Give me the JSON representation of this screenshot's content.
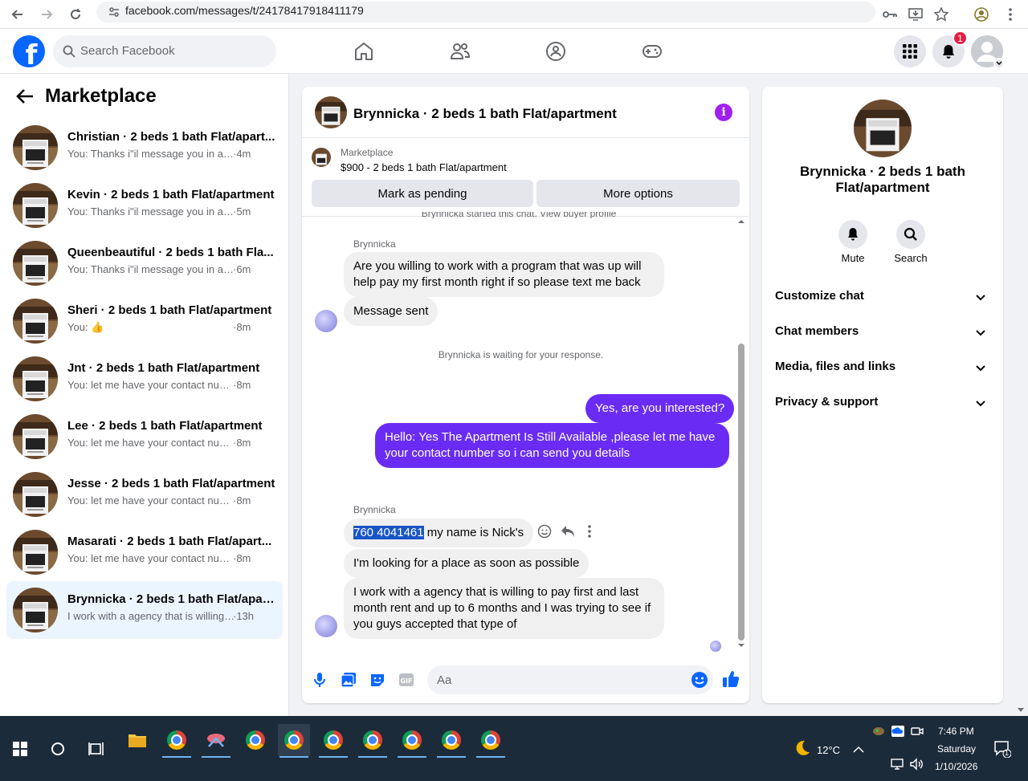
{
  "browser": {
    "url": "facebook.com/messages/t/24178417918411179"
  },
  "header": {
    "logo_letter": "f",
    "search_placeholder": "Search Facebook",
    "notification_count": "1"
  },
  "sidebar": {
    "title": "Marketplace",
    "conversations": [
      {
        "name": "Christian · 2 beds 1 bath Flat/apart...",
        "preview": "You: Thanks i\"il message you in a mo...",
        "time": "·4m"
      },
      {
        "name": "Kevin · 2 beds 1 bath Flat/apartment",
        "preview": "You: Thanks i\"il message you in a mo...",
        "time": "·5m"
      },
      {
        "name": "Queenbeautiful · 2 beds 1 bath Fla...",
        "preview": "You: Thanks i\"il message you in a mo...",
        "time": "·6m"
      },
      {
        "name": "Sheri · 2 beds 1 bath Flat/apartment",
        "preview": "You: 👍",
        "time": "·8m"
      },
      {
        "name": "Jnt · 2 beds 1 bath Flat/apartment",
        "preview": "You: let me have your contact numbe...",
        "time": "·8m"
      },
      {
        "name": "Lee · 2 beds 1 bath Flat/apartment",
        "preview": "You: let me have your contact numbe...",
        "time": "·8m"
      },
      {
        "name": "Jesse · 2 beds 1 bath Flat/apartment",
        "preview": "You: let me have your contact numbe...",
        "time": "·8m"
      },
      {
        "name": "Masarati · 2 beds 1 bath Flat/apart...",
        "preview": "You: let me have your contact numbe...",
        "time": "·8m"
      },
      {
        "name": "Brynnicka · 2 beds 1 bath Flat/apar...",
        "preview": "I work with a agency that is willing to...",
        "time": "·13h"
      }
    ]
  },
  "chat": {
    "title": "Brynnicka · 2 beds 1 bath Flat/apartment",
    "marketplace_label": "Marketplace",
    "listing": "$900 - 2 beds 1 bath Flat/apartment",
    "mark_pending": "Mark as pending",
    "more_options": "More options",
    "started_note": "Brynnicka started this chat. View buyer profile",
    "sender1": "Brynnicka",
    "msg1": "Are you willing to work with a program that was up will help pay my first month right if so please text me back",
    "msg2": "Message sent",
    "waiting": "Brynnicka is waiting for your response.",
    "out1": "Yes, are you interested?",
    "out2": "Hello: Yes The Apartment Is Still Available ,please let me have your contact number so i can send you details",
    "sender2": "Brynnicka",
    "msg3_phone": "760 4041461",
    "msg3_rest": " my name is Nick's",
    "msg4": "I'm looking for a place as soon as possible",
    "msg5": "I work with a agency that is willing to pay first and last month rent and up to 6 months and I was trying to see if you guys accepted that type of",
    "composer_placeholder": "Aa"
  },
  "rightpanel": {
    "name": "Brynnicka · 2 beds 1 bath Flat/apartment",
    "mute": "Mute",
    "search": "Search",
    "sections": [
      "Customize chat",
      "Chat members",
      "Media, files and links",
      "Privacy & support"
    ]
  },
  "taskbar": {
    "weather": "12°C",
    "time": "7:46 PM",
    "day": "Saturday",
    "date": "1/10/2026",
    "notif_count": "1"
  }
}
